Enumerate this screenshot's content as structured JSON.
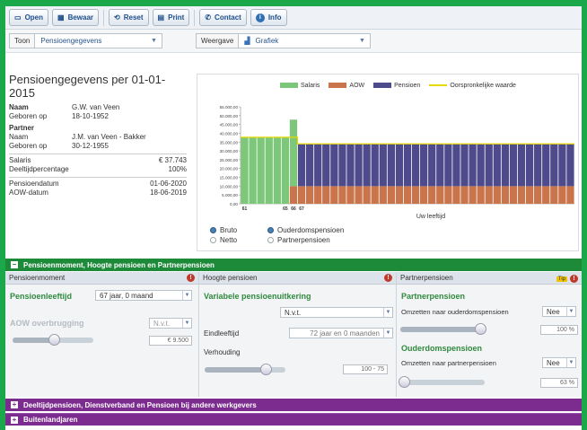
{
  "toolbar": {
    "open": "Open",
    "bewaar": "Bewaar",
    "reset": "Reset",
    "print": "Print",
    "contact": "Contact",
    "info": "Info"
  },
  "viewbar": {
    "toon_label": "Toon",
    "toon_value": "Pensioengegevens",
    "weergave_label": "Weergave",
    "weergave_value": "Grafiek"
  },
  "summary": {
    "title": "Pensioengegevens per 01-01-2015",
    "naam_label": "Naam",
    "naam_value": "G.W. van Veen",
    "geboren_label": "Geboren op",
    "geboren_value": "18-10-1952",
    "partner_heading": "Partner",
    "p_naam_label": "Naam",
    "p_naam_value": "J.M. van Veen - Bakker",
    "p_geboren_label": "Geboren op",
    "p_geboren_value": "30-12-1955",
    "salaris_label": "Salaris",
    "salaris_value": "€ 37.743",
    "deeltijd_label": "Deeltijdpercentage",
    "deeltijd_value": "100%",
    "pensioendatum_label": "Pensioendatum",
    "pensioendatum_value": "01-06-2020",
    "aow_label": "AOW-datum",
    "aow_value": "18-06-2019"
  },
  "chart_data": {
    "type": "bar",
    "stacked": true,
    "legend": [
      "Salaris",
      "AOW",
      "Pensioen",
      "Oorspronkelijke waarde"
    ],
    "legend_position": "top",
    "colors": {
      "Salaris": "#7dc77b",
      "AOW": "#c9744a",
      "Pensioen": "#4d4b8c",
      "Oorspronkelijke waarde": "#e8d800"
    },
    "y_ticks": [
      "55.000,00",
      "50.000,00",
      "45.000,00",
      "40.000,00",
      "35.000,00",
      "30.000,00",
      "25.000,00",
      "20.000,00",
      "15.000,00",
      "10.000,00",
      "5.000,00",
      "0,00"
    ],
    "ylim": [
      0,
      55000
    ],
    "x_tick_labels": [
      "61",
      "65",
      "66",
      "67"
    ],
    "xlabel": "Uw leeftijd",
    "series_phases": [
      {
        "phase": "salaris",
        "bars": 6,
        "salaris": 37743,
        "aow": 0,
        "pensioen": 0
      },
      {
        "phase": "aow-start",
        "bars": 1,
        "salaris": 37743,
        "aow": 10000,
        "pensioen": 0
      },
      {
        "phase": "pensioen",
        "bars": 34,
        "salaris": 0,
        "aow": 10000,
        "pensioen": 24000
      }
    ],
    "oorspronkelijke_waarde": {
      "before": 37743,
      "after": 34000
    }
  },
  "radios": {
    "bruto": "Bruto",
    "netto": "Netto",
    "ouderdom": "Ouderdomspensioen",
    "partner": "Partnerpensioen"
  },
  "section1": "Pensioenmoment, Hoogte pensioen en Partnerpensioen",
  "col1": {
    "header": "Pensioenmoment",
    "pl_label": "Pensioenleeftijd",
    "pl_value": "67 jaar, 0 maand",
    "aow_label": "AOW overbrugging",
    "aow_value": "N.v.t.",
    "amount": "€ 9.500"
  },
  "col2": {
    "header": "Hoogte pensioen",
    "var_label": "Variabele pensioenuitkering",
    "var_value": "N.v.t.",
    "eind_label": "Eindleeftijd",
    "eind_value": "72 jaar en 0 maanden",
    "verh_label": "Verhouding",
    "verh_value": "100 - 75"
  },
  "col3": {
    "header": "Partnerpensioen",
    "tip": "Tip",
    "pp_title": "Partnerpensioen",
    "omz1_label": "Omzetten naar ouderdomspensioen",
    "omz1_value": "Nee",
    "pct1": "100 %",
    "od_title": "Ouderdomspensioen",
    "omz2_label": "Omzetten naar partnerpensioen",
    "omz2_value": "Nee",
    "pct2": "63 %"
  },
  "section2": "Deeltijdpensioen, Dienstverband en Pensioen bij andere werkgevers",
  "section3": "Buitenlandjaren"
}
